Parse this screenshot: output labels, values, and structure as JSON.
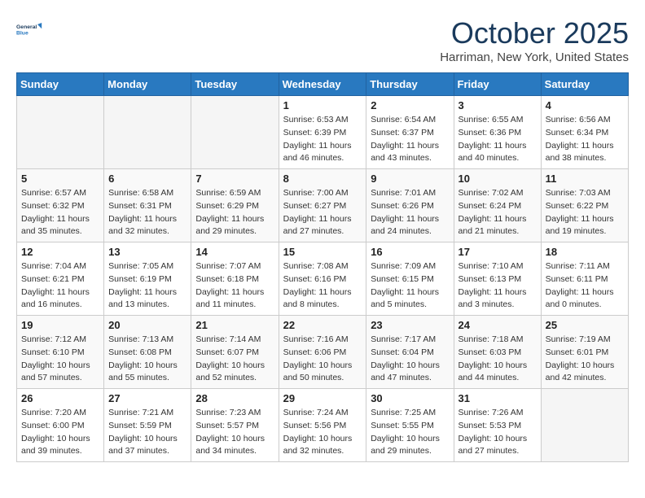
{
  "header": {
    "logo_line1": "General",
    "logo_line2": "Blue",
    "month": "October 2025",
    "location": "Harriman, New York, United States"
  },
  "weekdays": [
    "Sunday",
    "Monday",
    "Tuesday",
    "Wednesday",
    "Thursday",
    "Friday",
    "Saturday"
  ],
  "weeks": [
    [
      {
        "day": "",
        "info": ""
      },
      {
        "day": "",
        "info": ""
      },
      {
        "day": "",
        "info": ""
      },
      {
        "day": "1",
        "info": "Sunrise: 6:53 AM\nSunset: 6:39 PM\nDaylight: 11 hours\nand 46 minutes."
      },
      {
        "day": "2",
        "info": "Sunrise: 6:54 AM\nSunset: 6:37 PM\nDaylight: 11 hours\nand 43 minutes."
      },
      {
        "day": "3",
        "info": "Sunrise: 6:55 AM\nSunset: 6:36 PM\nDaylight: 11 hours\nand 40 minutes."
      },
      {
        "day": "4",
        "info": "Sunrise: 6:56 AM\nSunset: 6:34 PM\nDaylight: 11 hours\nand 38 minutes."
      }
    ],
    [
      {
        "day": "5",
        "info": "Sunrise: 6:57 AM\nSunset: 6:32 PM\nDaylight: 11 hours\nand 35 minutes."
      },
      {
        "day": "6",
        "info": "Sunrise: 6:58 AM\nSunset: 6:31 PM\nDaylight: 11 hours\nand 32 minutes."
      },
      {
        "day": "7",
        "info": "Sunrise: 6:59 AM\nSunset: 6:29 PM\nDaylight: 11 hours\nand 29 minutes."
      },
      {
        "day": "8",
        "info": "Sunrise: 7:00 AM\nSunset: 6:27 PM\nDaylight: 11 hours\nand 27 minutes."
      },
      {
        "day": "9",
        "info": "Sunrise: 7:01 AM\nSunset: 6:26 PM\nDaylight: 11 hours\nand 24 minutes."
      },
      {
        "day": "10",
        "info": "Sunrise: 7:02 AM\nSunset: 6:24 PM\nDaylight: 11 hours\nand 21 minutes."
      },
      {
        "day": "11",
        "info": "Sunrise: 7:03 AM\nSunset: 6:22 PM\nDaylight: 11 hours\nand 19 minutes."
      }
    ],
    [
      {
        "day": "12",
        "info": "Sunrise: 7:04 AM\nSunset: 6:21 PM\nDaylight: 11 hours\nand 16 minutes."
      },
      {
        "day": "13",
        "info": "Sunrise: 7:05 AM\nSunset: 6:19 PM\nDaylight: 11 hours\nand 13 minutes."
      },
      {
        "day": "14",
        "info": "Sunrise: 7:07 AM\nSunset: 6:18 PM\nDaylight: 11 hours\nand 11 minutes."
      },
      {
        "day": "15",
        "info": "Sunrise: 7:08 AM\nSunset: 6:16 PM\nDaylight: 11 hours\nand 8 minutes."
      },
      {
        "day": "16",
        "info": "Sunrise: 7:09 AM\nSunset: 6:15 PM\nDaylight: 11 hours\nand 5 minutes."
      },
      {
        "day": "17",
        "info": "Sunrise: 7:10 AM\nSunset: 6:13 PM\nDaylight: 11 hours\nand 3 minutes."
      },
      {
        "day": "18",
        "info": "Sunrise: 7:11 AM\nSunset: 6:11 PM\nDaylight: 11 hours\nand 0 minutes."
      }
    ],
    [
      {
        "day": "19",
        "info": "Sunrise: 7:12 AM\nSunset: 6:10 PM\nDaylight: 10 hours\nand 57 minutes."
      },
      {
        "day": "20",
        "info": "Sunrise: 7:13 AM\nSunset: 6:08 PM\nDaylight: 10 hours\nand 55 minutes."
      },
      {
        "day": "21",
        "info": "Sunrise: 7:14 AM\nSunset: 6:07 PM\nDaylight: 10 hours\nand 52 minutes."
      },
      {
        "day": "22",
        "info": "Sunrise: 7:16 AM\nSunset: 6:06 PM\nDaylight: 10 hours\nand 50 minutes."
      },
      {
        "day": "23",
        "info": "Sunrise: 7:17 AM\nSunset: 6:04 PM\nDaylight: 10 hours\nand 47 minutes."
      },
      {
        "day": "24",
        "info": "Sunrise: 7:18 AM\nSunset: 6:03 PM\nDaylight: 10 hours\nand 44 minutes."
      },
      {
        "day": "25",
        "info": "Sunrise: 7:19 AM\nSunset: 6:01 PM\nDaylight: 10 hours\nand 42 minutes."
      }
    ],
    [
      {
        "day": "26",
        "info": "Sunrise: 7:20 AM\nSunset: 6:00 PM\nDaylight: 10 hours\nand 39 minutes."
      },
      {
        "day": "27",
        "info": "Sunrise: 7:21 AM\nSunset: 5:59 PM\nDaylight: 10 hours\nand 37 minutes."
      },
      {
        "day": "28",
        "info": "Sunrise: 7:23 AM\nSunset: 5:57 PM\nDaylight: 10 hours\nand 34 minutes."
      },
      {
        "day": "29",
        "info": "Sunrise: 7:24 AM\nSunset: 5:56 PM\nDaylight: 10 hours\nand 32 minutes."
      },
      {
        "day": "30",
        "info": "Sunrise: 7:25 AM\nSunset: 5:55 PM\nDaylight: 10 hours\nand 29 minutes."
      },
      {
        "day": "31",
        "info": "Sunrise: 7:26 AM\nSunset: 5:53 PM\nDaylight: 10 hours\nand 27 minutes."
      },
      {
        "day": "",
        "info": ""
      }
    ]
  ]
}
